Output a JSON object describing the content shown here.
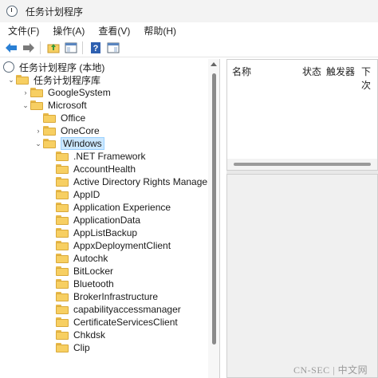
{
  "window": {
    "title": "任务计划程序"
  },
  "menu": [
    "文件(F)",
    "操作(A)",
    "查看(V)",
    "帮助(H)"
  ],
  "tree": {
    "root": "任务计划程序 (本地)",
    "library": "任务计划程序库",
    "items": [
      {
        "label": "GoogleSystem",
        "indent": 2,
        "expander": "chevron-right"
      },
      {
        "label": "Microsoft",
        "indent": 2,
        "expander": "chevron-down"
      },
      {
        "label": "Office",
        "indent": 3,
        "expander": ""
      },
      {
        "label": "OneCore",
        "indent": 3,
        "expander": "chevron-right"
      },
      {
        "label": "Windows",
        "indent": 3,
        "expander": "chevron-down",
        "selected": true
      },
      {
        "label": ".NET Framework",
        "indent": 4,
        "expander": ""
      },
      {
        "label": "AccountHealth",
        "indent": 4,
        "expander": ""
      },
      {
        "label": "Active Directory Rights Management",
        "indent": 4,
        "expander": ""
      },
      {
        "label": "AppID",
        "indent": 4,
        "expander": ""
      },
      {
        "label": "Application Experience",
        "indent": 4,
        "expander": ""
      },
      {
        "label": "ApplicationData",
        "indent": 4,
        "expander": ""
      },
      {
        "label": "AppListBackup",
        "indent": 4,
        "expander": ""
      },
      {
        "label": "AppxDeploymentClient",
        "indent": 4,
        "expander": ""
      },
      {
        "label": "Autochk",
        "indent": 4,
        "expander": ""
      },
      {
        "label": "BitLocker",
        "indent": 4,
        "expander": ""
      },
      {
        "label": "Bluetooth",
        "indent": 4,
        "expander": ""
      },
      {
        "label": "BrokerInfrastructure",
        "indent": 4,
        "expander": ""
      },
      {
        "label": "capabilityaccessmanager",
        "indent": 4,
        "expander": ""
      },
      {
        "label": "CertificateServicesClient",
        "indent": 4,
        "expander": ""
      },
      {
        "label": "Chkdsk",
        "indent": 4,
        "expander": ""
      },
      {
        "label": "Clip",
        "indent": 4,
        "expander": ""
      }
    ]
  },
  "list": {
    "columns": [
      "名称",
      "状态",
      "触发器",
      "下次"
    ]
  },
  "watermark": "CN-SEC | 中文网"
}
